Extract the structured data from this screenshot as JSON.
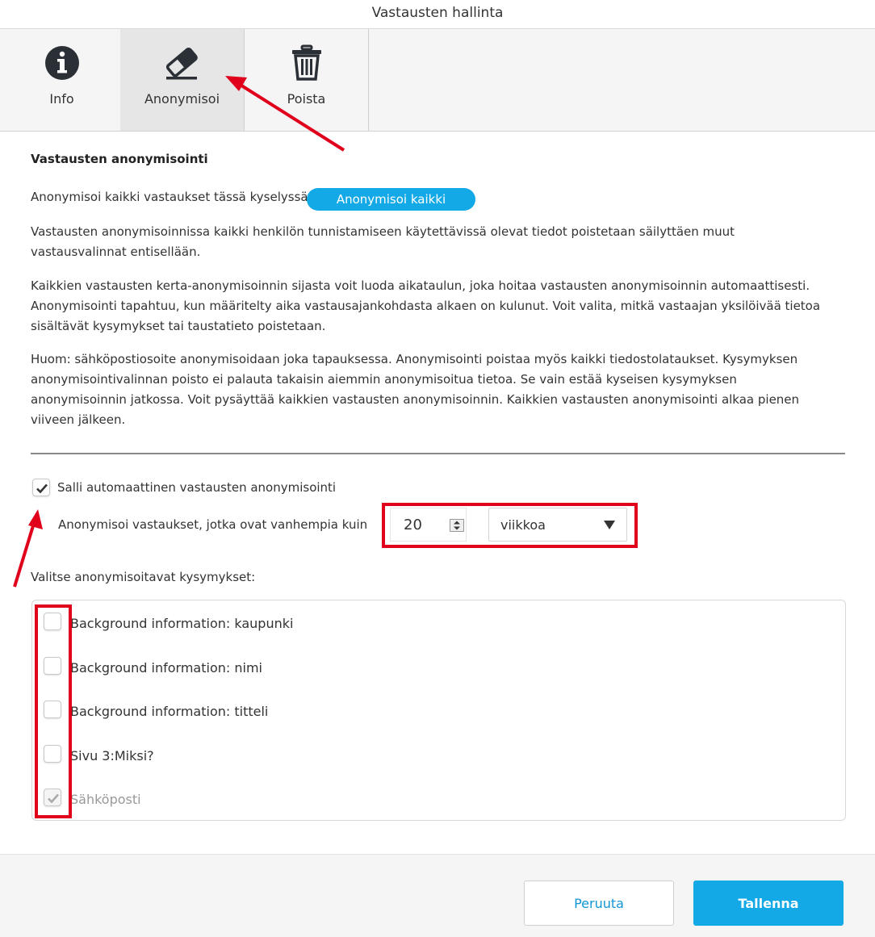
{
  "window": {
    "title": "Vastausten hallinta"
  },
  "tabs": [
    {
      "label": "Info",
      "icon": "info-icon",
      "active": false
    },
    {
      "label": "Anonymisoi",
      "icon": "eraser-icon",
      "active": true
    },
    {
      "label": "Poista",
      "icon": "trash-icon",
      "active": false
    }
  ],
  "section": {
    "title": "Vastausten anonymisointi",
    "anonymize_all_text": "Anonymisoi kaikki vastaukset tässä kyselyssä",
    "anonymize_all_button": "Anonymisoi kaikki",
    "paragraphs": [
      "Vastausten anonymisoinnissa kaikki henkilön tunnistamiseen käytettävissä olevat tiedot poistetaan säilyttäen muut vastausvalinnat entisellään.",
      "Kaikkien vastausten kerta-anonymisoinnin sijasta voit luoda aikataulun, joka hoitaa vastausten anonymisoinnin automaattisesti. Anonymisointi tapahtuu, kun määritelty aika vastausajankohdasta alkaen on kulunut. Voit valita, mitkä vastaajan yksilöivää tietoa sisältävät kysymykset tai taustatieto poistetaan.",
      "Huom: sähköpostiosoite anonymisoidaan joka tapauksessa. Anonymisointi poistaa myös kaikki tiedostolataukset. Kysymyksen anonymisointivalinnan poisto ei palauta takaisin aiemmin anonymisoitua tietoa. Se vain estää kyseisen kysymyksen anonymisoinnin jatkossa. Voit pysäyttää kaikkien vastausten anonymisoinnin. Kaikkien vastausten anonymisointi alkaa pienen viiveen jälkeen."
    ]
  },
  "auto": {
    "checkbox_label": "Salli automaattinen vastausten anonymisointi",
    "checked": true,
    "older_than_label": "Anonymisoi vastaukset, jotka ovat vanhempia kuin",
    "amount": "20",
    "unit": "viikkoa"
  },
  "questions": {
    "label": "Valitse anonymisoitavat kysymykset:",
    "items": [
      {
        "label": "Background information: kaupunki",
        "checked": false,
        "disabled": false
      },
      {
        "label": "Background information: nimi",
        "checked": false,
        "disabled": false
      },
      {
        "label": "Background information: titteli",
        "checked": false,
        "disabled": false
      },
      {
        "label": "Sivu 3:Miksi?",
        "checked": false,
        "disabled": false
      },
      {
        "label": "Sähköposti",
        "checked": true,
        "disabled": true
      }
    ]
  },
  "footer": {
    "cancel": "Peruuta",
    "save": "Tallenna"
  },
  "colors": {
    "accent": "#13a8e6",
    "annotation": "#e0001b"
  }
}
